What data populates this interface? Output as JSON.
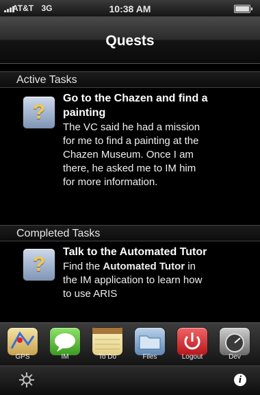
{
  "status_bar": {
    "carrier": "AT&T",
    "network": "3G",
    "time": "10:38 AM"
  },
  "navbar": {
    "title": "Quests"
  },
  "sections": [
    {
      "header": "Active Tasks",
      "items": [
        {
          "icon": "question-icon",
          "title_line1": "Go to the Chazen and find a",
          "title_line2": "painting",
          "description_lines": [
            "The VC said he had a mission",
            "for me to find a painting at the",
            "Chazen Museum. Once I am",
            "there, he asked me to IM him",
            "for more information."
          ]
        }
      ]
    },
    {
      "header": "Completed Tasks",
      "items": [
        {
          "icon": "question-icon",
          "title_line1": "Talk to the Automated Tutor",
          "description_parts": {
            "prefix": "Find the ",
            "bold": "Automated Tutor",
            "suffix": " in"
          },
          "description_lines": [
            "the IM application to learn how",
            "to use ARIS"
          ]
        }
      ]
    }
  ],
  "tab_bar": {
    "tabs": [
      {
        "label": "GPS",
        "icon": "map-icon",
        "color": "#d9c27a"
      },
      {
        "label": "IM",
        "icon": "chat-bubble-icon",
        "color": "#5bbf3a"
      },
      {
        "label": "To Do",
        "icon": "notepad-icon",
        "color": "#efe0a6"
      },
      {
        "label": "Files",
        "icon": "folder-icon",
        "color": "#7ea6cf"
      },
      {
        "label": "Logout",
        "icon": "power-icon",
        "color": "#d8262a"
      },
      {
        "label": "Dev",
        "icon": "gauge-icon",
        "color": "#8a8a8a"
      }
    ]
  },
  "bottom_bar": {
    "left_icon": "gear-icon",
    "right_icon": "info-icon",
    "info_glyph": "i"
  }
}
